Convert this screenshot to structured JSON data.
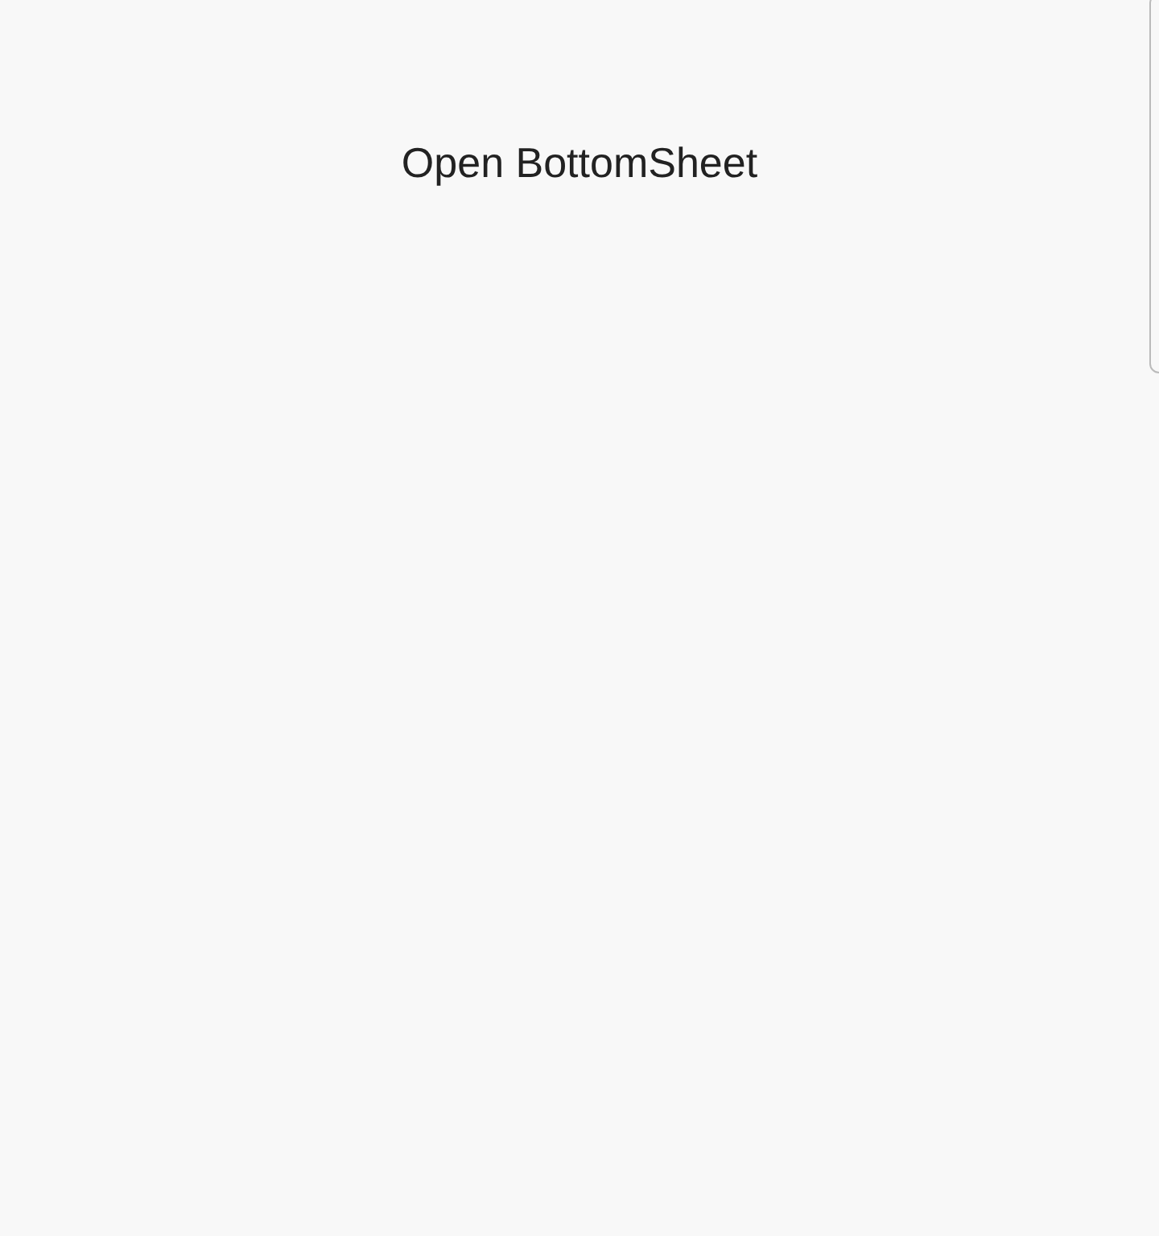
{
  "button": {
    "label": "Open BottomSheet"
  }
}
